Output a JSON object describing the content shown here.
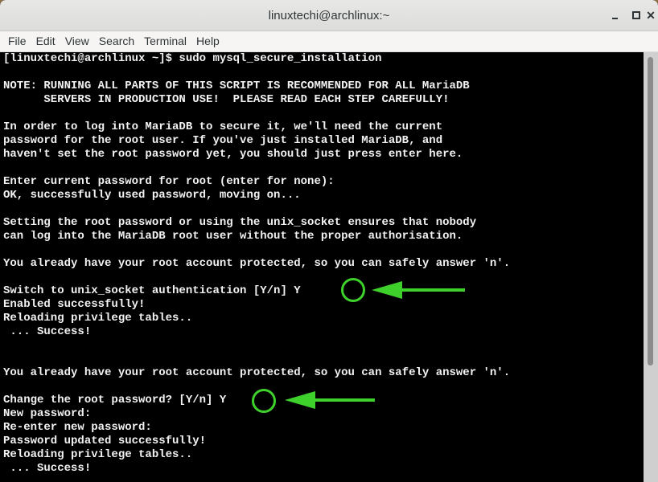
{
  "window": {
    "title": "linuxtechi@archlinux:~",
    "controls": {
      "minimize": "minimize",
      "maximize": "maximize",
      "close": "close"
    }
  },
  "menubar": {
    "items": [
      "File",
      "Edit",
      "View",
      "Search",
      "Terminal",
      "Help"
    ]
  },
  "terminal": {
    "lines": [
      "[linuxtechi@archlinux ~]$ sudo mysql_secure_installation",
      "",
      "NOTE: RUNNING ALL PARTS OF THIS SCRIPT IS RECOMMENDED FOR ALL MariaDB",
      "      SERVERS IN PRODUCTION USE!  PLEASE READ EACH STEP CAREFULLY!",
      "",
      "In order to log into MariaDB to secure it, we'll need the current",
      "password for the root user. If you've just installed MariaDB, and",
      "haven't set the root password yet, you should just press enter here.",
      "",
      "Enter current password for root (enter for none):",
      "OK, successfully used password, moving on...",
      "",
      "Setting the root password or using the unix_socket ensures that nobody",
      "can log into the MariaDB root user without the proper authorisation.",
      "",
      "You already have your root account protected, so you can safely answer 'n'.",
      "",
      "Switch to unix_socket authentication [Y/n] Y",
      "Enabled successfully!",
      "Reloading privilege tables..",
      " ... Success!",
      "",
      "",
      "You already have your root account protected, so you can safely answer 'n'.",
      "",
      "Change the root password? [Y/n] Y",
      "New password:",
      "Re-enter new password:",
      "Password updated successfully!",
      "Reloading privilege tables..",
      " ... Success!"
    ]
  },
  "annotations": {
    "color": "#3ed12b",
    "highlights": [
      {
        "target": "Switch to unix_socket authentication answer",
        "text": "Y"
      },
      {
        "target": "Change the root password answer",
        "text": "Y"
      }
    ]
  }
}
